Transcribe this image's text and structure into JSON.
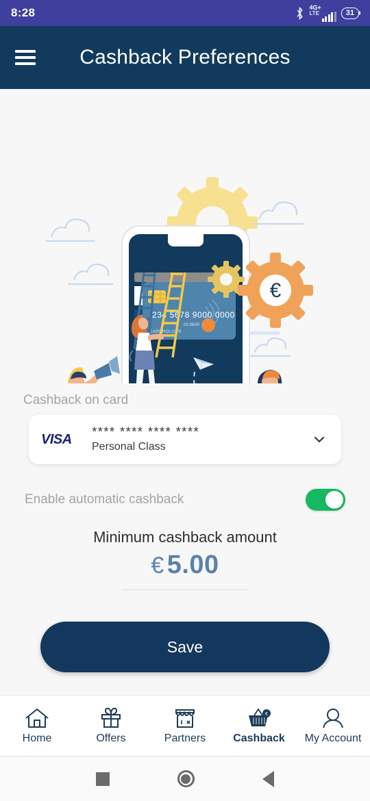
{
  "status_bar": {
    "time": "8:28",
    "bluetooth_icon": "bluetooth-icon",
    "network_type": "4G+",
    "network_sub": "LTE",
    "battery_percent": "31"
  },
  "app_bar": {
    "menu_icon": "hamburger-menu-icon",
    "title": "Cashback Preferences"
  },
  "illustration": {
    "name": "cashback-settings-illustration",
    "card_number": "234 5678 9000 0000",
    "card_expiry": "02.06/00",
    "card_holder": "CARDHOLDER",
    "gear_symbol": "€"
  },
  "form": {
    "card_label": "Cashback on card",
    "card_brand": "VISA",
    "card_number_masked": "**** **** **** ****",
    "card_type": "Personal Class",
    "dropdown_icon": "chevron-down-icon",
    "toggle_label": "Enable automatic cashback",
    "toggle_state": "on",
    "amount_title": "Minimum cashback amount",
    "amount_currency": "€",
    "amount_value": "5.00",
    "save_label": "Save"
  },
  "bottom_nav": {
    "items": [
      {
        "label": "Home",
        "icon": "home-icon",
        "active": false
      },
      {
        "label": "Offers",
        "icon": "gift-icon",
        "active": false
      },
      {
        "label": "Partners",
        "icon": "storefront-icon",
        "active": false
      },
      {
        "label": "Cashback",
        "icon": "basket-euro-icon",
        "active": true
      },
      {
        "label": "My Account",
        "icon": "person-icon",
        "active": false
      }
    ]
  },
  "android_nav": {
    "recents_icon": "square-recents-icon",
    "home_icon": "circle-home-icon",
    "back_icon": "triangle-back-icon"
  },
  "colors": {
    "status_bar": "#3f3f9e",
    "app_bar": "#123a5c",
    "accent_navy": "#14375e",
    "toggle_green": "#16b95f",
    "amount_blue": "#5a82ab",
    "gear_orange": "#f0a259",
    "gear_yellow": "#f7e08f"
  }
}
